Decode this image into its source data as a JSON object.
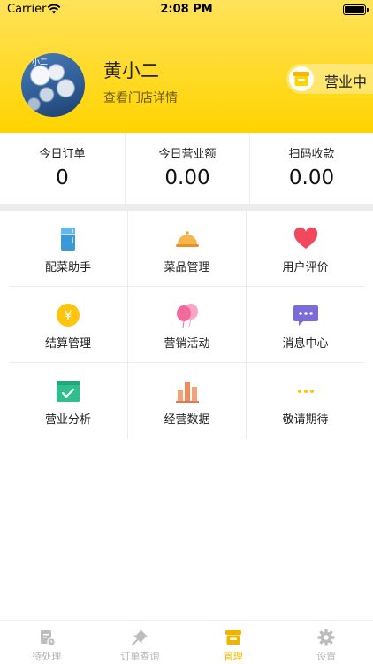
{
  "status_bar": {
    "carrier": "Carrier",
    "time": "2:08 PM"
  },
  "profile": {
    "avatar_tag": "小二",
    "store_name": "黄小二",
    "detail_link": "查看门店详情",
    "status_label": "营业中"
  },
  "stats": [
    {
      "label": "今日订单",
      "value": "0"
    },
    {
      "label": "今日营业额",
      "value": "0.00"
    },
    {
      "label": "扫码收款",
      "value": "0.00"
    }
  ],
  "menu": [
    {
      "label": "配菜助手",
      "icon": "fridge-icon"
    },
    {
      "label": "菜品管理",
      "icon": "food-cloche-icon"
    },
    {
      "label": "用户评价",
      "icon": "heart-icon"
    },
    {
      "label": "结算管理",
      "icon": "yuan-coin-icon"
    },
    {
      "label": "营销活动",
      "icon": "balloons-icon"
    },
    {
      "label": "消息中心",
      "icon": "message-bubble-icon"
    },
    {
      "label": "营业分析",
      "icon": "analysis-chart-icon"
    },
    {
      "label": "经营数据",
      "icon": "bar-chart-icon"
    },
    {
      "label": "敬请期待",
      "icon": "more-dots-icon"
    }
  ],
  "tabbar": [
    {
      "label": "待处理",
      "icon": "pending-doc-icon",
      "active": false
    },
    {
      "label": "订单查询",
      "icon": "pin-icon",
      "active": false
    },
    {
      "label": "管理",
      "icon": "shop-manage-icon",
      "active": true
    },
    {
      "label": "设置",
      "icon": "gear-icon",
      "active": false
    }
  ],
  "colors": {
    "accent": "#ffd400",
    "active_tab": "#f0b400",
    "inactive_tab": "#b5b5b5"
  }
}
